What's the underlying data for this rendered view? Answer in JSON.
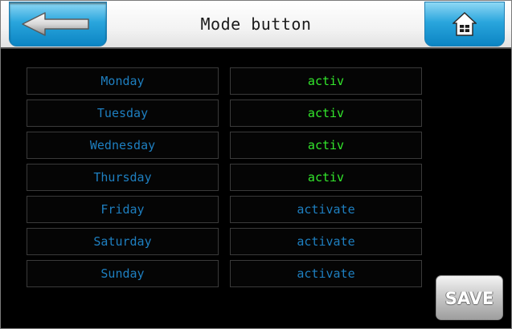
{
  "header": {
    "title": "Mode button",
    "back_icon": "back-arrow-icon",
    "home_icon": "house-icon"
  },
  "days": [
    {
      "label": "Monday",
      "state": "activ",
      "active": true
    },
    {
      "label": "Tuesday",
      "state": "activ",
      "active": true
    },
    {
      "label": "Wednesday",
      "state": "activ",
      "active": true
    },
    {
      "label": "Thursday",
      "state": "activ",
      "active": true
    },
    {
      "label": "Friday",
      "state": "activate",
      "active": false
    },
    {
      "label": "Saturday",
      "state": "activate",
      "active": false
    },
    {
      "label": "Sunday",
      "state": "activate",
      "active": false
    }
  ],
  "save_label": "SAVE",
  "colors": {
    "accent_blue": "#2aa6dd",
    "day_text": "#1e7fc0",
    "active_text": "#33e62c",
    "inactive_text": "#1e7fc0",
    "background": "#000000"
  }
}
